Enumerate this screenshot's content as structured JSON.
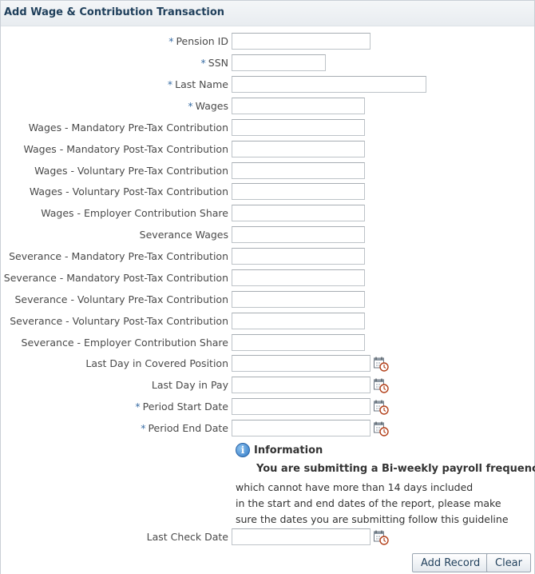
{
  "header": {
    "title": "Add Wage & Contribution Transaction"
  },
  "form": {
    "required_mark": "*",
    "fields": [
      {
        "label": "Pension ID",
        "required": true,
        "value": ""
      },
      {
        "label": "SSN",
        "required": true,
        "value": ""
      },
      {
        "label": "Last Name",
        "required": true,
        "value": ""
      },
      {
        "label": "Wages",
        "required": true,
        "value": ""
      },
      {
        "label": "Wages - Mandatory Pre-Tax Contribution",
        "required": false,
        "value": ""
      },
      {
        "label": "Wages - Mandatory Post-Tax Contribution",
        "required": false,
        "value": ""
      },
      {
        "label": "Wages - Voluntary Pre-Tax Contribution",
        "required": false,
        "value": ""
      },
      {
        "label": "Wages - Voluntary Post-Tax Contribution",
        "required": false,
        "value": ""
      },
      {
        "label": "Wages - Employer Contribution Share",
        "required": false,
        "value": ""
      },
      {
        "label": "Severance Wages",
        "required": false,
        "value": ""
      },
      {
        "label": "Severance - Mandatory Pre-Tax Contribution",
        "required": false,
        "value": ""
      },
      {
        "label": "Severance - Mandatory Post-Tax Contribution",
        "required": false,
        "value": ""
      },
      {
        "label": "Severance - Voluntary Pre-Tax Contribution",
        "required": false,
        "value": ""
      },
      {
        "label": "Severance - Voluntary Post-Tax Contribution",
        "required": false,
        "value": ""
      },
      {
        "label": "Severance - Employer Contribution Share",
        "required": false,
        "value": ""
      },
      {
        "label": "Last Day in Covered Position",
        "required": false,
        "value": "",
        "icon": "calendar-clock-icon"
      },
      {
        "label": "Last Day in Pay",
        "required": false,
        "value": "",
        "icon": "calendar-clock-icon"
      },
      {
        "label": "Period Start Date",
        "required": true,
        "value": "",
        "icon": "calendar-clock-icon"
      },
      {
        "label": "Period End Date",
        "required": true,
        "value": "",
        "icon": "calendar-clock-icon"
      },
      {
        "label": "Last Check Date",
        "required": false,
        "value": "",
        "icon": "calendar-clock-icon"
      }
    ]
  },
  "info": {
    "icon": "info-icon",
    "title": "Information",
    "headline": "You are submitting a Bi-weekly payroll frequency",
    "lines": [
      "which cannot have more than 14 days included",
      "in the start and end dates of the report, please make",
      "sure the dates you are submitting follow this guideline"
    ]
  },
  "buttons": {
    "add_record": "Add Record",
    "clear": "Clear"
  },
  "colors": {
    "accent": "#3a6ea5",
    "title": "#1f3f5b",
    "label": "#4a4a4a"
  }
}
